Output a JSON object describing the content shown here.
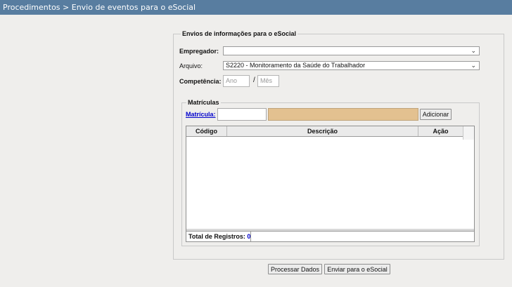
{
  "header": {
    "title": "Procedimentos > Envio de eventos para o eSocial"
  },
  "form": {
    "legend": "Envios de informações para o eSocial",
    "empregador": {
      "label": "Empregador:",
      "value": ""
    },
    "arquivo": {
      "label": "Arquivo:",
      "value": "S2220 - Monitoramento da Saúde do Trabalhador"
    },
    "competencia": {
      "label": "Competência:",
      "ano_placeholder": "Ano",
      "separator": "/",
      "mes_placeholder": "Mês"
    }
  },
  "matriculas": {
    "legend": "Matrículas",
    "link_label": "Matrícula:",
    "input_value": "",
    "add_button": "Adicionar",
    "columns": [
      "Código",
      "Descrição",
      "Ação"
    ],
    "rows": [],
    "total_label": "Total de Registros:",
    "total_value": "0"
  },
  "actions": {
    "process_button": "Processar Dados",
    "send_button": "Enviar para o eSocial"
  },
  "icons": {
    "select_arrow": "chevron-down-icon"
  }
}
